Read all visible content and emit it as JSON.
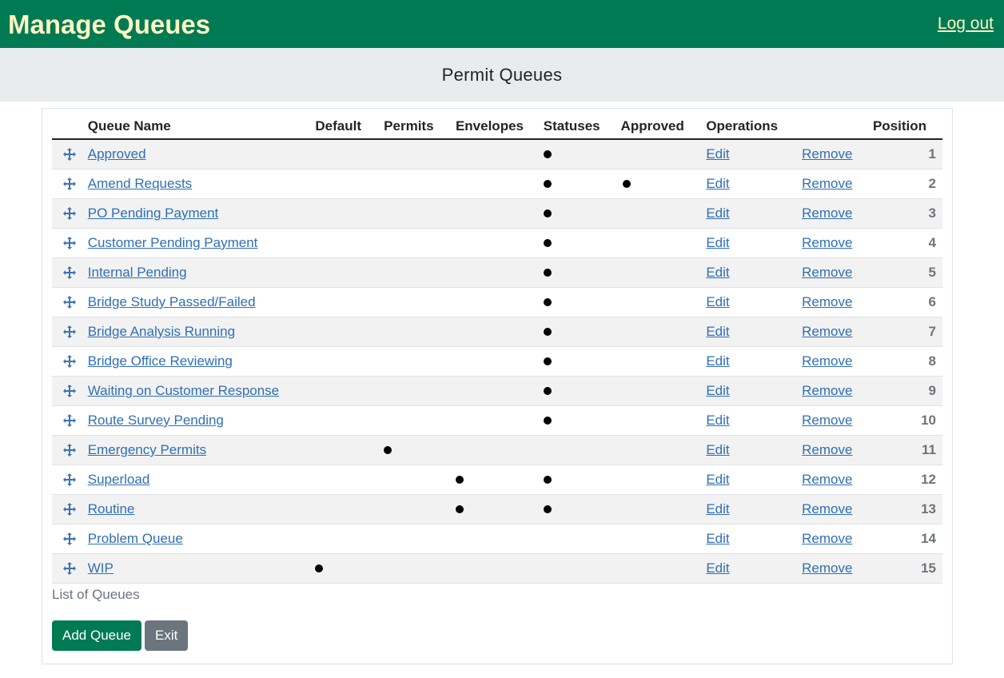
{
  "header": {
    "title": "Manage Queues",
    "logout_label": "Log out"
  },
  "subheader": {
    "title": "Permit Queues"
  },
  "table": {
    "columns": [
      "Queue Name",
      "Default",
      "Permits",
      "Envelopes",
      "Statuses",
      "Approved",
      "Operations",
      "Position"
    ],
    "rows": [
      {
        "name": "Approved",
        "default": false,
        "permits": false,
        "envelopes": false,
        "statuses": true,
        "approved": false,
        "edit": "Edit",
        "remove": "Remove",
        "position": "1"
      },
      {
        "name": "Amend Requests",
        "default": false,
        "permits": false,
        "envelopes": false,
        "statuses": true,
        "approved": true,
        "edit": "Edit",
        "remove": "Remove",
        "position": "2"
      },
      {
        "name": "PO Pending Payment",
        "default": false,
        "permits": false,
        "envelopes": false,
        "statuses": true,
        "approved": false,
        "edit": "Edit",
        "remove": "Remove",
        "position": "3"
      },
      {
        "name": "Customer Pending Payment",
        "default": false,
        "permits": false,
        "envelopes": false,
        "statuses": true,
        "approved": false,
        "edit": "Edit",
        "remove": "Remove",
        "position": "4"
      },
      {
        "name": "Internal Pending",
        "default": false,
        "permits": false,
        "envelopes": false,
        "statuses": true,
        "approved": false,
        "edit": "Edit",
        "remove": "Remove",
        "position": "5"
      },
      {
        "name": "Bridge Study Passed/Failed",
        "default": false,
        "permits": false,
        "envelopes": false,
        "statuses": true,
        "approved": false,
        "edit": "Edit",
        "remove": "Remove",
        "position": "6"
      },
      {
        "name": "Bridge Analysis Running",
        "default": false,
        "permits": false,
        "envelopes": false,
        "statuses": true,
        "approved": false,
        "edit": "Edit",
        "remove": "Remove",
        "position": "7"
      },
      {
        "name": "Bridge Office Reviewing",
        "default": false,
        "permits": false,
        "envelopes": false,
        "statuses": true,
        "approved": false,
        "edit": "Edit",
        "remove": "Remove",
        "position": "8"
      },
      {
        "name": "Waiting on Customer Response",
        "default": false,
        "permits": false,
        "envelopes": false,
        "statuses": true,
        "approved": false,
        "edit": "Edit",
        "remove": "Remove",
        "position": "9"
      },
      {
        "name": "Route Survey Pending",
        "default": false,
        "permits": false,
        "envelopes": false,
        "statuses": true,
        "approved": false,
        "edit": "Edit",
        "remove": "Remove",
        "position": "10"
      },
      {
        "name": "Emergency Permits",
        "default": false,
        "permits": true,
        "envelopes": false,
        "statuses": false,
        "approved": false,
        "edit": "Edit",
        "remove": "Remove",
        "position": "11"
      },
      {
        "name": "Superload",
        "default": false,
        "permits": false,
        "envelopes": true,
        "statuses": true,
        "approved": false,
        "edit": "Edit",
        "remove": "Remove",
        "position": "12"
      },
      {
        "name": "Routine",
        "default": false,
        "permits": false,
        "envelopes": true,
        "statuses": true,
        "approved": false,
        "edit": "Edit",
        "remove": "Remove",
        "position": "13"
      },
      {
        "name": "Problem Queue",
        "default": false,
        "permits": false,
        "envelopes": false,
        "statuses": false,
        "approved": false,
        "edit": "Edit",
        "remove": "Remove",
        "position": "14"
      },
      {
        "name": "WIP",
        "default": true,
        "permits": false,
        "envelopes": false,
        "statuses": false,
        "approved": false,
        "edit": "Edit",
        "remove": "Remove",
        "position": "15"
      }
    ],
    "caption": "List of Queues"
  },
  "buttons": {
    "add_label": "Add Queue",
    "exit_label": "Exit"
  },
  "colors": {
    "brand": "#007a53",
    "title_text": "#fdf6c3",
    "link": "#2f6fb7",
    "secondary": "#6c757d"
  },
  "icons": {
    "drag_handle": "move-arrows-icon",
    "flag": "filled-dot-icon"
  }
}
